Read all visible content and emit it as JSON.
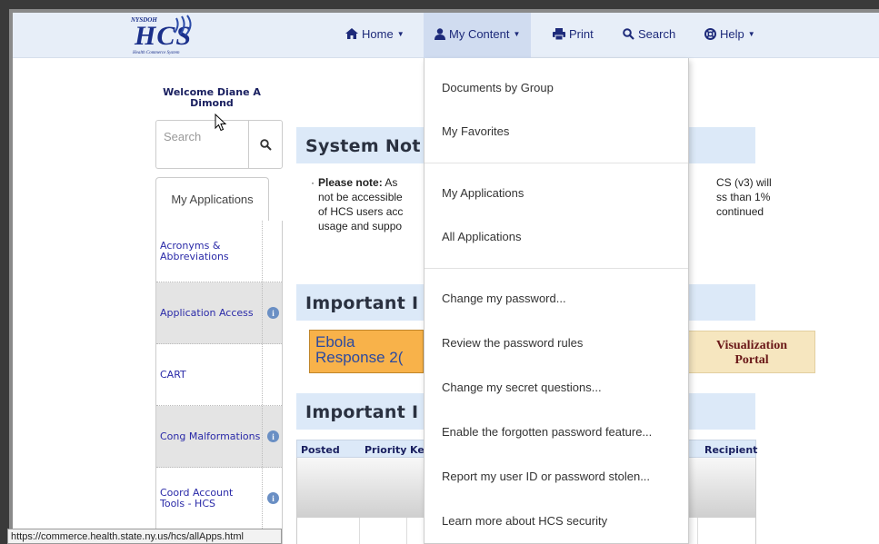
{
  "logo": {
    "top_text": "NYSDOH",
    "main_text": "HCS",
    "sub_text": "Health Commerce System"
  },
  "nav": {
    "home": "Home",
    "my_content": "My Content",
    "print": "Print",
    "search": "Search",
    "help": "Help"
  },
  "welcome": {
    "line1": "Welcome Diane A",
    "line2": "Dimond"
  },
  "search": {
    "placeholder": "Search"
  },
  "apps_tab": {
    "label": "My Applications"
  },
  "apps": [
    {
      "name_line1": "Acronyms &",
      "name_line2": "Abbreviations",
      "info": false
    },
    {
      "name_line1": "Application Access",
      "name_line2": "",
      "info": true
    },
    {
      "name_line1": "CART",
      "name_line2": "",
      "info": false
    },
    {
      "name_line1": "Cong Malformations",
      "name_line2": "",
      "info": true
    },
    {
      "name_line1": "Coord Account",
      "name_line2": "Tools - HCS",
      "info": true
    }
  ],
  "main": {
    "system_notice_title": "System Not",
    "notice": {
      "bold": "Please note:",
      "line1": "As",
      "line2": "not be accessible",
      "line3": "of HCS users acc",
      "line4": "usage and suppo",
      "right1": "CS (v3) will",
      "right2": "ss than 1%",
      "right3": "continued"
    },
    "important1_title": "Important I",
    "ebola": {
      "line1": "Ebola",
      "line2": "Response 2("
    },
    "viz": {
      "line1": "Visualization",
      "line2": "Portal"
    },
    "important2_title": "Important I",
    "table_headers": {
      "posted": "Posted",
      "priority": "Priority",
      "key": "Ke",
      "recipient": "Recipient"
    }
  },
  "dropdown": {
    "items": [
      "Documents by Group",
      "My Favorites",
      "My Applications",
      "All Applications",
      "Change my password...",
      "Review the password rules",
      "Change my secret questions...",
      "Enable the forgotten password feature...",
      "Report my user ID or password stolen...",
      "Learn more about HCS security"
    ]
  },
  "status_bar": {
    "url": "https://commerce.health.state.ny.us/hcs/allApps.html"
  },
  "colors": {
    "nav_bg": "#e7eef8",
    "nav_text": "#1d2a7a",
    "panel_bg": "#dce9f8",
    "link": "#2a2aa8"
  }
}
